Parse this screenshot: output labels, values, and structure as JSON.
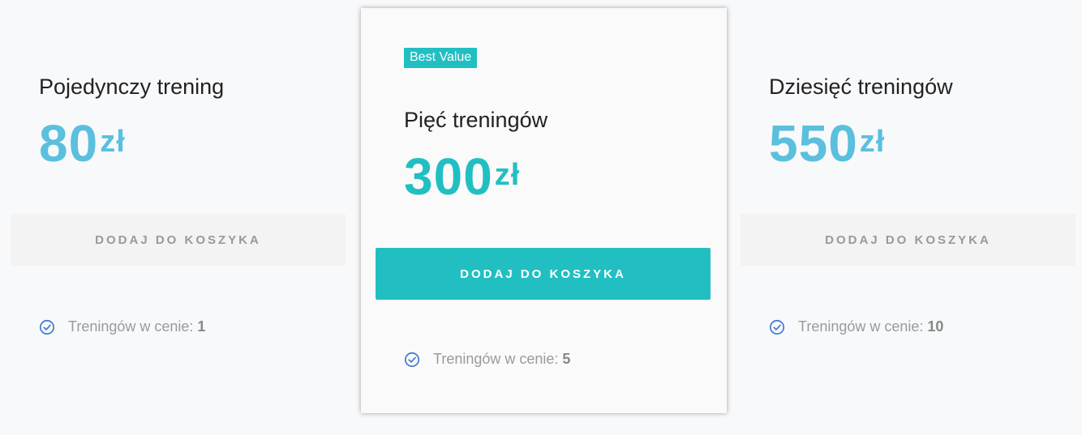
{
  "plans": [
    {
      "title": "Pojedynczy trening",
      "price": "80",
      "currency": "zł",
      "button": "DODAJ DO KOSZYKA",
      "feature_label": "Treningów w cenie:",
      "feature_value": "1"
    },
    {
      "badge": "Best Value",
      "title": "Pięć treningów",
      "price": "300",
      "currency": "zł",
      "button": "DODAJ DO KOSZYKA",
      "feature_label": "Treningów w cenie:",
      "feature_value": "5"
    },
    {
      "title": "Dziesięć treningów",
      "price": "550",
      "currency": "zł",
      "button": "DODAJ DO KOSZYKA",
      "feature_label": "Treningów w cenie:",
      "feature_value": "10"
    }
  ],
  "colors": {
    "accent": "#21bfc2",
    "price_blue": "#5bbfde",
    "check_icon": "#4a7fd0"
  },
  "icons": {
    "feature": "check-circle-icon"
  }
}
